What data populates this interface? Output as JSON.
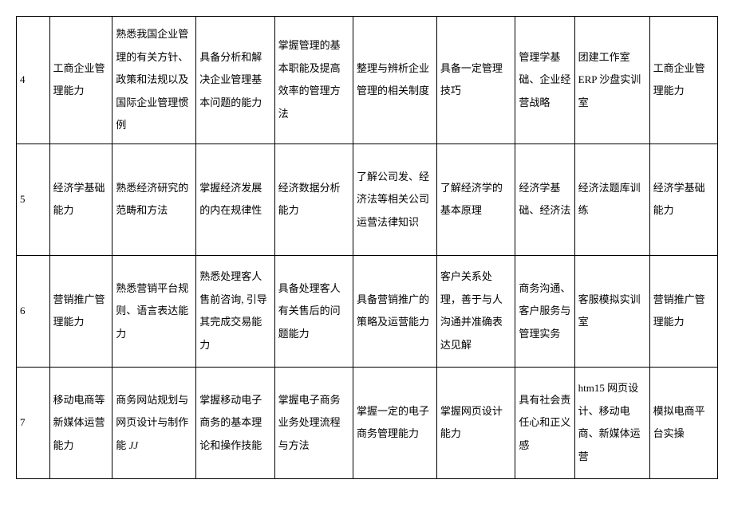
{
  "rows": [
    {
      "num": "4",
      "c1": "工商企业管理能力",
      "c2": "熟悉我国企业管理的有关方针、政策和法规以及国际企业管理惯例",
      "c3": "具备分析和解决企业管理基本问题的能力",
      "c4": "掌握管理的基本职能及提高效率的管理方法",
      "c5": "整理与辨析企业管理的相关制度",
      "c6": "具备一定管理技巧",
      "c7": "管理学基础、企业经营战略",
      "c8": "团建工作室ERP 沙盘实训室",
      "c9": "工商企业管理能力"
    },
    {
      "num": "5",
      "c1": "经济学基础能力",
      "c2": "熟悉经济研究的范畴和方法",
      "c3": "掌握经济发展的内在规律性",
      "c4": "经济数据分析能力",
      "c5": "了解公司发、经济法等相关公司运营法律知识",
      "c6": "了解经济学的基本原理",
      "c7": "经济学基础、经济法",
      "c8": "经济法题库训练",
      "c9": "经济学基础能力"
    },
    {
      "num": "6",
      "c1": "营销推广管理能力",
      "c2": "熟悉营销平台规则、语言表达能力",
      "c3": "熟悉处理客人售前咨询, 引导其完成交易能力",
      "c4": "具备处理客人有关售后的问题能力",
      "c5": "具备营销推广的策略及运营能力",
      "c6": "客户关系处理，善于与人沟通并准确表达见解",
      "c7": "商务沟通、客户服务与管理实务",
      "c8": "客服模拟实训室",
      "c9": "营销推广管理能力"
    },
    {
      "num": "7",
      "c1": "移动电商等新媒体运营能力",
      "c2_pre": "商务网站规划与网页设计与制作能 ",
      "c2_jj": "JJ",
      "c3": "掌握移动电子商务的基本理论和操作技能",
      "c4": "掌握电子商务业务处理流程与方法",
      "c5": "掌握一定的电子商务管理能力",
      "c6": "掌握网页设计能力",
      "c7": "具有社会责任心和正义感",
      "c8": "htm15 网页设计、移动电商、新媒体运营",
      "c9": "模拟电商平台实操"
    }
  ]
}
